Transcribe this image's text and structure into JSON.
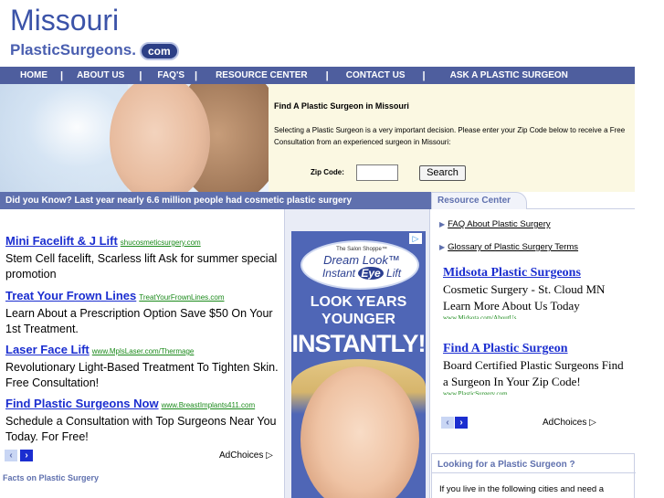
{
  "header": {
    "title": "Missouri",
    "subtitle": "PlasticSurgeons.",
    "badge": "com"
  },
  "nav": {
    "items": [
      {
        "label": "HOME"
      },
      {
        "label": "ABOUT US"
      },
      {
        "label": "FAQ's"
      },
      {
        "label": "RESOURCE CENTER"
      },
      {
        "label": "CONTACT US"
      },
      {
        "label": "ASK A PLASTIC SURGEON"
      }
    ],
    "separator": "|"
  },
  "search": {
    "title": "Find A Plastic Surgeon in Missouri",
    "text": "Selecting a Plastic Surgeon is a very important decision. Please enter your Zip Code below to receive a Free Consultation from an experienced surgeon in Missouri:",
    "zip_label": "Zip Code:",
    "zip_value": "",
    "button_label": "Search"
  },
  "did_you_know": "Did you Know? Last year nearly 6.6 million people had cosmetic plastic surgery",
  "ads": [
    {
      "title": "Mini Facelift & J Lift",
      "url": "shucosmeticsurgery.com",
      "desc": "Stem Cell facelift, Scarless lift Ask for summer special promotion"
    },
    {
      "title": "Treat Your Frown Lines",
      "url": "TreatYourFrownLines.com",
      "desc": "Learn About a Prescription Option Save $50 On Your 1st Treatment."
    },
    {
      "title": "Laser Face Lift",
      "url": "www.MplsLaser.com/Thermage",
      "desc": "Revolutionary Light-Based Treatment To Tighten Skin. Free Consultation!"
    },
    {
      "title": "Find Plastic Surgeons Now",
      "url": "www.BreastImplants411.com",
      "desc": "Schedule a Consultation with Top Surgeons Near You Today. For Free!"
    }
  ],
  "ad_controls": {
    "prev": "‹",
    "next": "›",
    "adchoices": "AdChoices"
  },
  "facts_title": "Facts on Plastic Surgery",
  "banner": {
    "small": "The Salon Shoppe™",
    "dream": "Dream Look™",
    "instant": "Instant",
    "eye": "Eye",
    "lift": "Lift",
    "line1": "LOOK YEARS",
    "line2": "YOUNGER",
    "line3": "INSTANTLY!",
    "ad_icon": "▷"
  },
  "resource_center": {
    "tab_label": "Resource Center",
    "links": [
      {
        "label": "FAQ About Plastic Surgery"
      },
      {
        "label": "Glossary of Plastic Surgery Terms"
      }
    ],
    "ads": [
      {
        "title": "Midsota Plastic Surgeons",
        "desc": "Cosmetic Surgery - St. Cloud MN Learn More About Us Today",
        "url": "www.Midsota.com/AboutUs"
      },
      {
        "title": "Find A Plastic Surgeon",
        "desc": "Board Certified Plastic Surgeons Find a Surgeon In Your Zip Code!",
        "url": "www.PlasticSurgery.com"
      }
    ]
  },
  "looking_box": {
    "title": "Looking for a Plastic Surgeon ?",
    "text": "If you live in the following cities and need a"
  },
  "colors": {
    "nav_bg": "#4e5e9e",
    "link_blue": "#1b2ed0",
    "url_green": "#1b8a1b",
    "accent": "#5f70ae",
    "search_bg": "#fbf8e2"
  }
}
